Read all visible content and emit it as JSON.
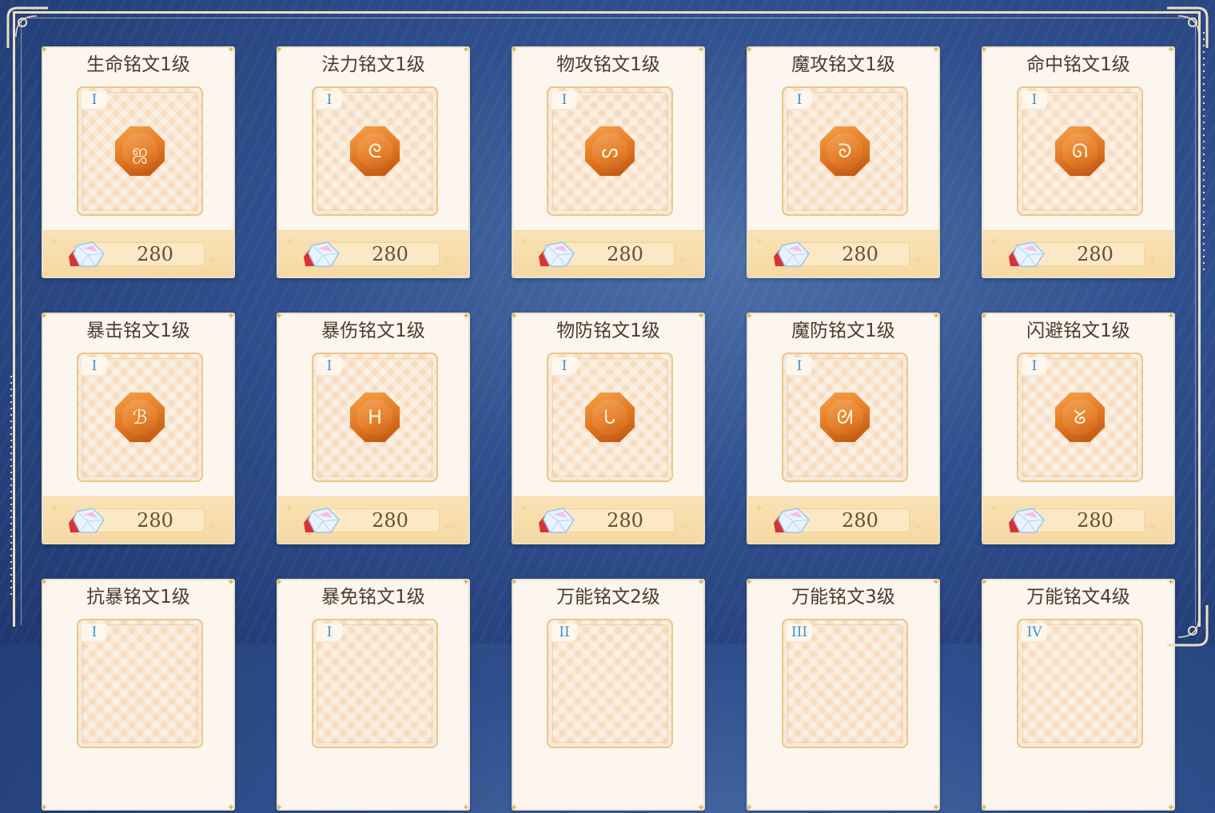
{
  "colors": {
    "background": "#2f4f8c",
    "card": "#fdf6ee",
    "card_footer": "#f6d9a4",
    "title_text": "#4b3b2b",
    "tier_text": "#3d8fd6",
    "price_text": "#6a4e32",
    "gem": "#e07622"
  },
  "currency_icon": "crystal-gem-icon",
  "items": [
    {
      "name": "生命铭文1级",
      "tier": "I",
      "price": "280",
      "icon": "rune-gem-life-icon",
      "glyph": "ஜ"
    },
    {
      "name": "法力铭文1级",
      "tier": "I",
      "price": "280",
      "icon": "rune-gem-mana-icon",
      "glyph": "ᘓ"
    },
    {
      "name": "物攻铭文1级",
      "tier": "I",
      "price": "280",
      "icon": "rune-gem-physical-attack-icon",
      "glyph": "ᔕ"
    },
    {
      "name": "魔攻铭文1级",
      "tier": "I",
      "price": "280",
      "icon": "rune-gem-magic-attack-icon",
      "glyph": "ᘐ"
    },
    {
      "name": "命中铭文1级",
      "tier": "I",
      "price": "280",
      "icon": "rune-gem-accuracy-icon",
      "glyph": "ᘏ"
    },
    {
      "name": "暴击铭文1级",
      "tier": "I",
      "price": "280",
      "icon": "rune-gem-crit-icon",
      "glyph": "ℬ"
    },
    {
      "name": "暴伤铭文1级",
      "tier": "I",
      "price": "280",
      "icon": "rune-gem-crit-damage-icon",
      "glyph": "ᕼ"
    },
    {
      "name": "物防铭文1级",
      "tier": "I",
      "price": "280",
      "icon": "rune-gem-physical-defense-icon",
      "glyph": "ᘂ"
    },
    {
      "name": "魔防铭文1级",
      "tier": "I",
      "price": "280",
      "icon": "rune-gem-magic-defense-icon",
      "glyph": "ᘛ"
    },
    {
      "name": "闪避铭文1级",
      "tier": "I",
      "price": "280",
      "icon": "rune-gem-evasion-icon",
      "glyph": "ᘜ"
    },
    {
      "name": "抗暴铭文1级",
      "tier": "I",
      "price": "",
      "icon": "",
      "glyph": ""
    },
    {
      "name": "暴免铭文1级",
      "tier": "I",
      "price": "",
      "icon": "",
      "glyph": ""
    },
    {
      "name": "万能铭文2级",
      "tier": "II",
      "price": "",
      "icon": "",
      "glyph": ""
    },
    {
      "name": "万能铭文3级",
      "tier": "III",
      "price": "",
      "icon": "",
      "glyph": ""
    },
    {
      "name": "万能铭文4级",
      "tier": "IV",
      "price": "",
      "icon": "",
      "glyph": ""
    }
  ]
}
